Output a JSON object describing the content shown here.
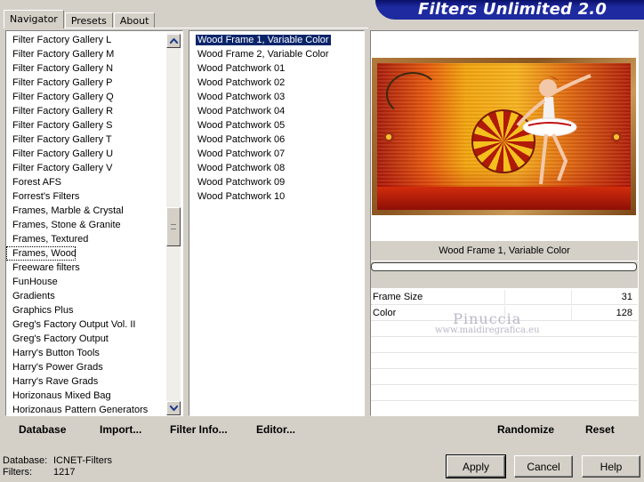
{
  "banner": {
    "title": "Filters Unlimited 2.0"
  },
  "tabs": [
    {
      "label": "Navigator",
      "active": true
    },
    {
      "label": "Presets",
      "active": false
    },
    {
      "label": "About",
      "active": false
    }
  ],
  "categories": [
    "Filter Factory Gallery L",
    "Filter Factory Gallery M",
    "Filter Factory Gallery N",
    "Filter Factory Gallery P",
    "Filter Factory Gallery Q",
    "Filter Factory Gallery R",
    "Filter Factory Gallery S",
    "Filter Factory Gallery T",
    "Filter Factory Gallery U",
    "Filter Factory Gallery V",
    "Forest AFS",
    "Forrest's Filters",
    "Frames, Marble & Crystal",
    "Frames, Stone & Granite",
    "Frames, Textured",
    "Frames, Wood",
    "Freeware filters",
    "FunHouse",
    "Gradients",
    "Graphics Plus",
    "Greg's Factory Output Vol. II",
    "Greg's Factory Output",
    "Harry's Button Tools",
    "Harry's Power Grads",
    "Harry's Rave Grads",
    "Horizonaus Mixed Bag",
    "Horizonaus Pattern Generators"
  ],
  "selected_category": "Frames, Wood",
  "filters": [
    "Wood Frame 1, Variable Color",
    "Wood Frame 2, Variable Color",
    "Wood Patchwork 01",
    "Wood Patchwork 02",
    "Wood Patchwork 03",
    "Wood Patchwork 04",
    "Wood Patchwork 05",
    "Wood Patchwork 06",
    "Wood Patchwork 07",
    "Wood Patchwork 08",
    "Wood Patchwork 09",
    "Wood Patchwork 10"
  ],
  "selected_filter": "Wood Frame 1, Variable Color",
  "preview": {
    "filter_name": "Wood Frame 1, Variable Color"
  },
  "params": [
    {
      "name": "Frame Size",
      "value": "31"
    },
    {
      "name": "Color",
      "value": "128"
    }
  ],
  "watermark": {
    "name": "Pinuccia",
    "url": "www.maidiregrafica.eu"
  },
  "toolbar_left": {
    "database": "Database",
    "import": "Import...",
    "filter_info": "Filter Info...",
    "editor": "Editor..."
  },
  "toolbar_right": {
    "randomize": "Randomize",
    "reset": "Reset"
  },
  "status": {
    "database_label": "Database:",
    "database_value": "ICNET-Filters",
    "filters_label": "Filters:",
    "filters_value": "1217"
  },
  "buttons": {
    "apply": "Apply",
    "cancel": "Cancel",
    "help": "Help"
  },
  "colors": {
    "dialog_bg": "#d4d0c8",
    "banner_bg": "#1e2aa0",
    "selection": "#0a246a"
  }
}
